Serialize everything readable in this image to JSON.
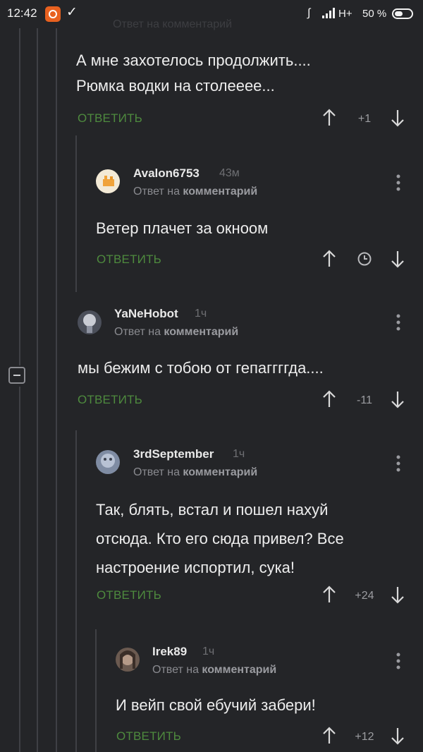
{
  "status_bar": {
    "time": "12:42",
    "network": "H+",
    "battery": "50 %"
  },
  "comments": [
    {
      "author": "",
      "ago": "",
      "reply_label": "Ответ на",
      "reply_target": "комментарий",
      "body_lines": [
        "А мне захотелось продолжить....",
        "Рюмка водки на столееее..."
      ],
      "reply_button": "ОТВЕТИТЬ",
      "rating": "+1"
    },
    {
      "author": "Avalon6753",
      "ago": "43м",
      "reply_label": "Ответ на",
      "reply_target": "комментарий",
      "body_lines": [
        "Ветер плачет за окноом"
      ],
      "reply_button": "ОТВЕТИТЬ",
      "rating_icon": "clock-icon"
    },
    {
      "author": "YaNeHobot",
      "ago": "1ч",
      "reply_label": "Ответ на",
      "reply_target": "комментарий",
      "body_lines": [
        "мы бежим с тобою от гепаггггда...."
      ],
      "reply_button": "ОТВЕТИТЬ",
      "rating": "-11"
    },
    {
      "author": "3rdSeptember",
      "ago": "1ч",
      "reply_label": "Ответ на",
      "reply_target": "комментарий",
      "body_lines": [
        "Так, блять, встал и пошел нахуй",
        "отсюда. Кто его сюда привел? Все",
        "настроение испортил, сука!"
      ],
      "reply_button": "ОТВЕТИТЬ",
      "rating": "+24"
    },
    {
      "author": "Irek89",
      "ago": "1ч",
      "reply_label": "Ответ на",
      "reply_target": "комментарий",
      "body_lines": [
        "И вейп свой ебучий забери!"
      ],
      "reply_button": "ОТВЕТИТЬ",
      "rating": "+12"
    }
  ],
  "colors": {
    "background": "#242528",
    "reply_green": "#4e8a3e",
    "thread_line": "#3f4045"
  }
}
